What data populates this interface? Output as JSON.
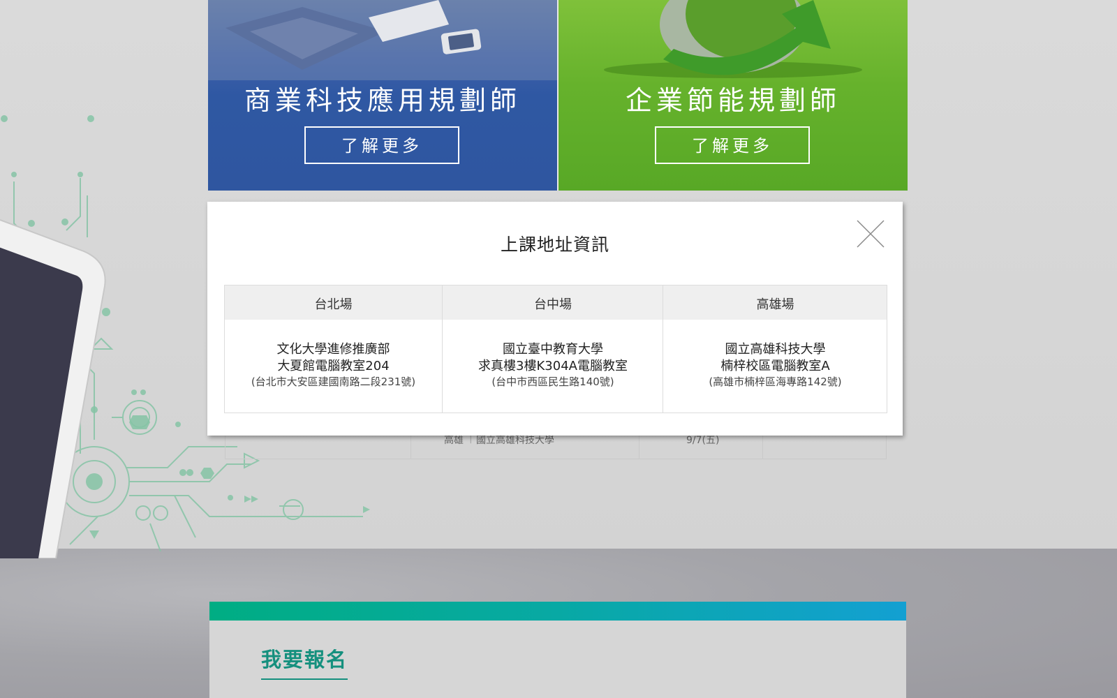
{
  "cards": [
    {
      "title": "商業科技應用規劃師",
      "button": "了解更多",
      "color": "#2f58a3"
    },
    {
      "title": "企業節能規劃師",
      "button": "了解更多",
      "color": "#5fae2a"
    }
  ],
  "background_table": {
    "location": "高雄",
    "venue": "國立高雄科技大學",
    "date": "9/7(五)"
  },
  "modal": {
    "title": "上課地址資訊",
    "columns": [
      {
        "header": "台北場",
        "line1": "文化大學進修推廣部",
        "line2": "大夏館電腦教室204",
        "address": "(台北市大安區建國南路二段231號)"
      },
      {
        "header": "台中場",
        "line1": "國立臺中教育大學",
        "line2": "求真樓3樓K304A電腦教室",
        "address": "(台中市西區民生路140號)"
      },
      {
        "header": "高雄場",
        "line1": "國立高雄科技大學",
        "line2": "楠梓校區電腦教室A",
        "address": "(高雄市楠梓區海專路142號)"
      }
    ]
  },
  "registration": {
    "title": "我要報名"
  },
  "colors": {
    "accent_green": "#15907e",
    "bar_start": "#00ad83",
    "bar_end": "#13a0d2"
  }
}
